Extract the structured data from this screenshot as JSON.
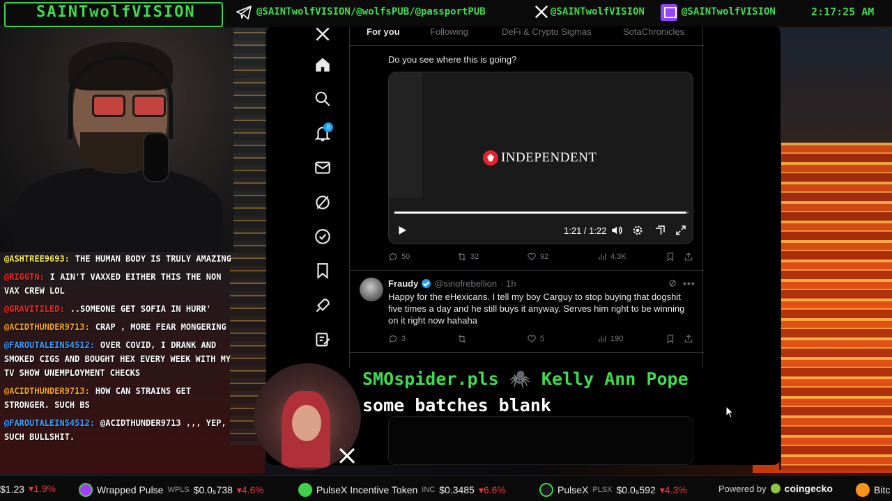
{
  "banner": {
    "brand": "SAINTwolfVISION",
    "telegram_handle": "@SAINTwolfVISION/@wolfsPUB/@passportPUB",
    "x_handle": "@SAINTwolfVISION",
    "twitch_handle": "@SAINTwolfVISION",
    "clock": "2:17:25 AM",
    "accent_color": "#3fdc4e"
  },
  "chat": {
    "messages": [
      {
        "user": "@ASHTREE9693:",
        "user_color": "#f6e94a",
        "text": "THE HUMAN BODY IS TRULY AMAZING"
      },
      {
        "user": "@RIGGTN:",
        "user_color": "#e0302a",
        "text": "I AIN'T VAXXED EITHER THIS THE NON VAX CREW LOL"
      },
      {
        "user": "@GRAVITILED:",
        "user_color": "#e0302a",
        "text": "..SOMEONE GET SOFIA IN HURR'"
      },
      {
        "user": "@ACIDTHUNDER9713:",
        "user_color": "#f6a623",
        "text": "CRAP , MORE FEAR MONGERING"
      },
      {
        "user": "@FAROUTALEINS4512:",
        "user_color": "#3aa0ff",
        "text": "OVER COVID, I DRANK AND SMOKED CIGS AND BOUGHT HEX EVERY WEEK WITH MY TV SHOW UNEMPLOYMENT CHECKS"
      },
      {
        "user": "@ACIDTHUNDER9713:",
        "user_color": "#f6a623",
        "text": "HOW CAN STRAINS GET STRONGER. SUCH BS"
      },
      {
        "user": "@FAROUTALEINS4512:",
        "user_color": "#3aa0ff",
        "text": "@ACIDTHUNDER9713 ,,, YEP, SUCH BULLSHIT."
      }
    ]
  },
  "x_app": {
    "nav": {
      "icons": [
        "x-logo-icon",
        "home-icon",
        "search-icon",
        "bell-icon",
        "mail-icon",
        "grok-icon",
        "verified-icon",
        "bookmark-icon",
        "rocket-icon",
        "compose-icon"
      ],
      "notification_count": "8"
    },
    "tabs": [
      "For you",
      "Following",
      "DeFi & Crypto Sigmas",
      "SotaChronicles"
    ],
    "tweet1": {
      "text": "Do you see where this is going?",
      "video": {
        "brand": "INDEPENDENT",
        "time": "1:21 / 1:22",
        "progress": 0.99
      },
      "stats": {
        "replies": "50",
        "reposts": "32",
        "likes": "92",
        "views": "4.3K"
      }
    },
    "tweet2": {
      "name": "Fraudy",
      "handle": "@sinofrebellion",
      "time": "· 1h",
      "text": "Happy for the eHexicans. I tell my boy Carguy to stop buying that dogshit five times a day and he still buys it anyway. Serves him right to be winning on it right now hahaha",
      "stats": {
        "replies": "3",
        "reposts": "",
        "likes": "5",
        "views": "190"
      }
    },
    "more_glyph": "•••"
  },
  "alert": {
    "name": "SMOspider.pls 🕷️ Kelly Ann Pope",
    "message": "some batches blank"
  },
  "ticker": {
    "items": [
      {
        "name": "",
        "symbol": "",
        "price": "$1.23",
        "change": "▾1.9%",
        "coin_color": ""
      },
      {
        "name": "Wrapped Pulse",
        "symbol": "WPLS",
        "price": "$0.0₅738",
        "change": "▾4.6%",
        "coin_color": "#a43cff"
      },
      {
        "name": "PulseX Incentive Token",
        "symbol": "INC",
        "price": "$0.3485",
        "change": "▾6.6%",
        "coin_color": "#3fd14a"
      },
      {
        "name": "PulseX",
        "symbol": "PLSX",
        "price": "$0.0₅592",
        "change": "▾4.3%",
        "coin_color": "#1a1a1a"
      }
    ],
    "powered_by": "Powered by",
    "powered_brand": "coingecko",
    "tail": "Bitc"
  }
}
